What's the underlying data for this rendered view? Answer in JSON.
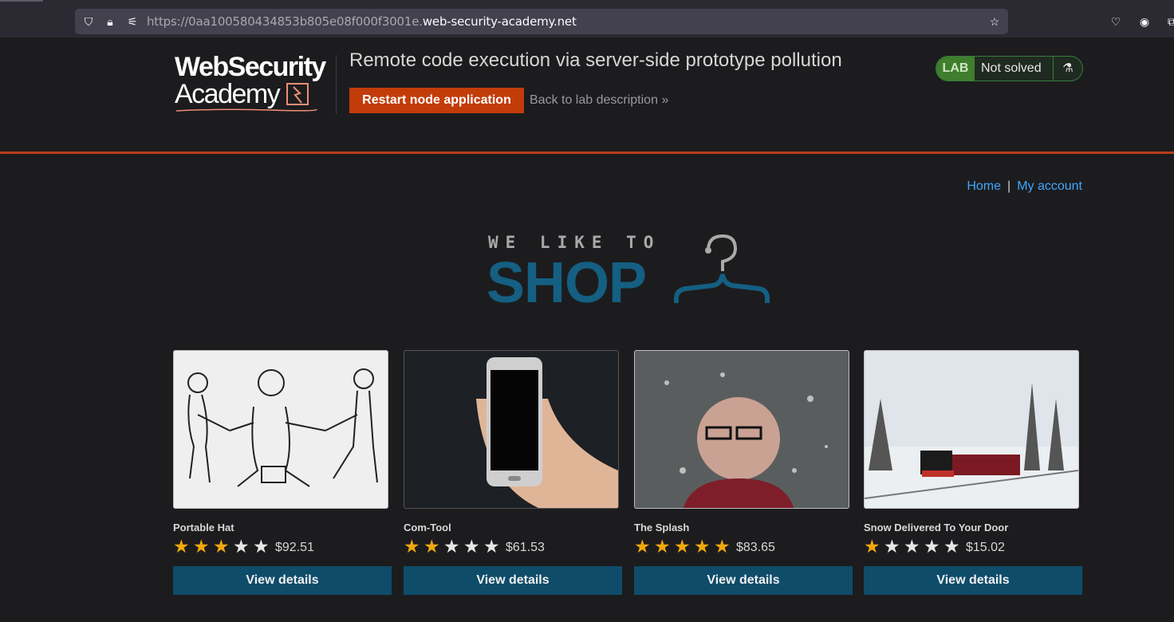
{
  "browser": {
    "url_prefix": "https://0aa100580434853b805e08f000f3001e.",
    "url_host": "web-security-academy.net",
    "icons": [
      "shield-icon",
      "lock-icon",
      "permissions-icon",
      "bookmark-star-icon",
      "pocket-icon",
      "account-icon",
      "extensions-icon"
    ]
  },
  "lab": {
    "logo_line1": "WebSecurity",
    "logo_line2": "Academy",
    "title": "Remote code execution via server-side prototype pollution",
    "restart_label": "Restart node application",
    "back_label": "Back to lab description",
    "back_arrow": "»",
    "badge_lab": "LAB",
    "badge_status": "Not solved",
    "accent_color": "#b73e18"
  },
  "nav": {
    "home": "Home",
    "separator": "|",
    "account": "My account"
  },
  "shop": {
    "tagline": "WE LIKE TO",
    "name": "SHOP"
  },
  "products": [
    {
      "name": "Portable Hat",
      "rating": 3,
      "price": "$92.51",
      "button": "View details"
    },
    {
      "name": "Com-Tool",
      "rating": 2,
      "price": "$61.53",
      "button": "View details"
    },
    {
      "name": "The Splash",
      "rating": 5,
      "price": "$83.65",
      "button": "View details"
    },
    {
      "name": "Snow Delivered To Your Door",
      "rating": 1,
      "price": "$15.02",
      "button": "View details"
    }
  ]
}
